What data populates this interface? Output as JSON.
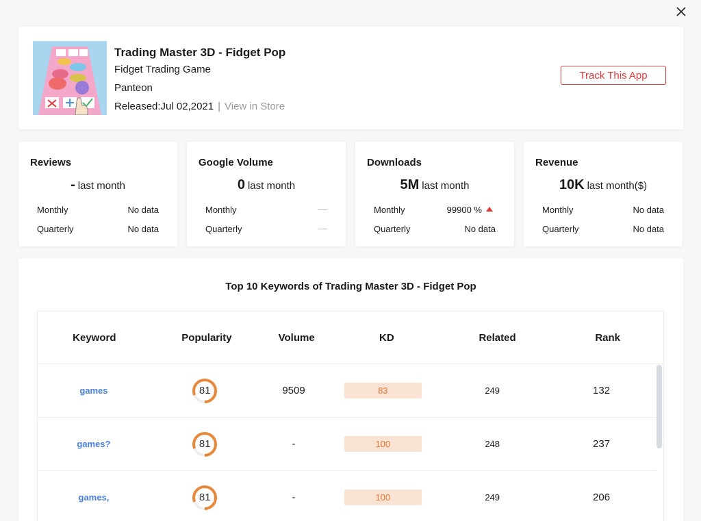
{
  "app": {
    "title": "Trading Master 3D - Fidget Pop",
    "category": "Fidget Trading Game",
    "developer": "Panteon",
    "released": "Released:Jul 02,2021",
    "separator": "|",
    "view_store": "View in Store",
    "track_label": "Track This App"
  },
  "stats": [
    {
      "title": "Reviews",
      "main_value": "-",
      "main_unit": "last month",
      "monthly_label": "Monthly",
      "monthly_value": "No data",
      "quarterly_label": "Quarterly",
      "quarterly_value": "No data"
    },
    {
      "title": "Google Volume",
      "main_value": "0",
      "main_unit": "last month",
      "monthly_label": "Monthly",
      "monthly_value": "",
      "quarterly_label": "Quarterly",
      "quarterly_value": ""
    },
    {
      "title": "Downloads",
      "main_value": "5M",
      "main_unit": "last month",
      "monthly_label": "Monthly",
      "monthly_value": "99900 %",
      "quarterly_label": "Quarterly",
      "quarterly_value": "No data"
    },
    {
      "title": "Revenue",
      "main_value": "10K",
      "main_unit": "last month($)",
      "monthly_label": "Monthly",
      "monthly_value": "No data",
      "quarterly_label": "Quarterly",
      "quarterly_value": "No data"
    }
  ],
  "keywords": {
    "title": "Top 10 Keywords of Trading Master 3D - Fidget Pop",
    "columns": [
      "Keyword",
      "Popularity",
      "Volume",
      "KD",
      "Related",
      "Rank"
    ],
    "rows": [
      {
        "keyword": "games",
        "popularity": "81",
        "popularity_pct": 81,
        "volume": "9509",
        "kd": "83",
        "related": "249",
        "rank": "132"
      },
      {
        "keyword": "games?",
        "popularity": "81",
        "popularity_pct": 81,
        "volume": "-",
        "kd": "100",
        "related": "248",
        "rank": "237"
      },
      {
        "keyword": "games,",
        "popularity": "81",
        "popularity_pct": 81,
        "volume": "-",
        "kd": "100",
        "related": "249",
        "rank": "206"
      }
    ]
  },
  "colors": {
    "accent_red": "#e0393b",
    "link_blue": "#4a7fd8",
    "ring_orange": "#e8883a",
    "kd_bg": "#fbe3d3"
  }
}
